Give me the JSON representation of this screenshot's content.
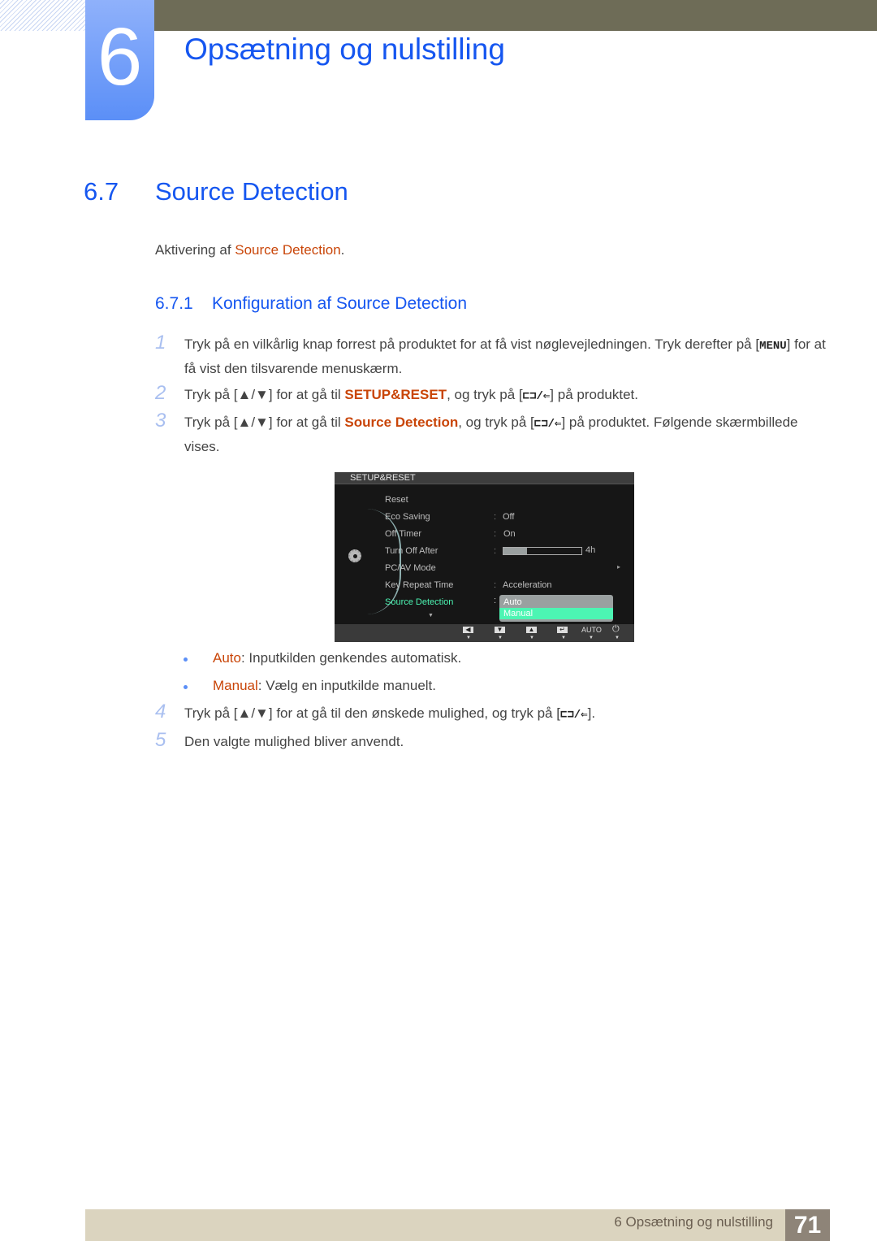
{
  "chapter": {
    "number": "6",
    "title": "Opsætning og nulstilling"
  },
  "section": {
    "number": "6.7",
    "title": "Source Detection"
  },
  "intro": {
    "prefix": "Aktivering af ",
    "highlight": "Source Detection",
    "suffix": "."
  },
  "subsection": {
    "number": "6.7.1",
    "title": "Konfiguration af Source Detection"
  },
  "steps": [
    {
      "n": "1",
      "text_a": "Tryk på en vilkårlig knap forrest på produktet for at få vist nøglevejledningen. Tryk derefter på [",
      "key": "MENU",
      "text_b": "] for at få vist den tilsvarende menuskærm."
    },
    {
      "n": "2",
      "text_a": "Tryk på [▲/▼] for at gå til ",
      "highlight": "SETUP&RESET",
      "text_b": ", og tryk på [",
      "key": "⊏⊐/⇐",
      "text_c": "] på produktet."
    },
    {
      "n": "3",
      "text_a": "Tryk på [▲/▼] for at gå til ",
      "highlight": "Source Detection",
      "text_b": ", og tryk på [",
      "key": "⊏⊐/⇐",
      "text_c": "] på produktet. Følgende skærmbillede vises."
    },
    {
      "n": "4",
      "text_a": "Tryk på [▲/▼] for at gå til den ønskede mulighed, og tryk på [",
      "key": "⊏⊐/⇐",
      "text_b": "]."
    },
    {
      "n": "5",
      "text_a": "Den valgte mulighed bliver anvendt."
    }
  ],
  "bullets": [
    {
      "label": "Auto",
      "text": ": Inputkilden genkendes automatisk."
    },
    {
      "label": "Manual",
      "text": ": Vælg en inputkilde manuelt."
    }
  ],
  "osd": {
    "title": "SETUP&RESET",
    "items": [
      {
        "label": "Reset",
        "value": ""
      },
      {
        "label": "Eco Saving",
        "value": "Off"
      },
      {
        "label": "Off Timer",
        "value": "On"
      },
      {
        "label": "Turn Off After",
        "value": "4h",
        "progress": 0.3
      },
      {
        "label": "PC/AV Mode",
        "value": "▸"
      },
      {
        "label": "Key Repeat Time",
        "value": "Acceleration"
      },
      {
        "label": "Source Detection",
        "value": ""
      }
    ],
    "dropdown": {
      "options": [
        "Auto",
        "Manual"
      ],
      "selected": "Manual"
    },
    "footer": {
      "left": "◀",
      "down": "▼",
      "up": "▲",
      "enter": "↵",
      "auto": "AUTO",
      "power": "⏻"
    },
    "colors": {
      "active": "#4cf5b3"
    }
  },
  "footer": {
    "chapter_label": "6 Opsætning og nulstilling",
    "page": "71"
  },
  "colors": {
    "heading": "#1556f0",
    "highlight": "#c94508"
  }
}
